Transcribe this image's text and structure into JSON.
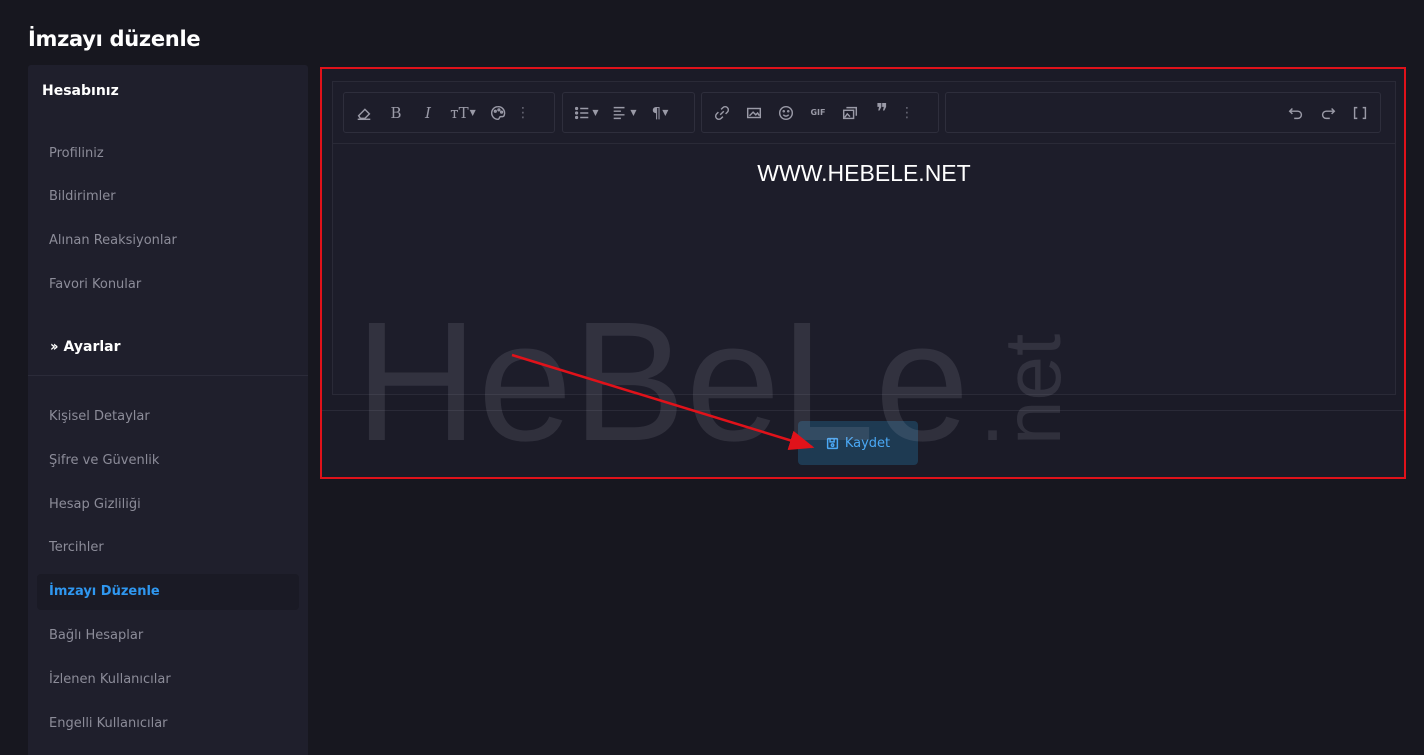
{
  "page": {
    "title": "İmzayı düzenle"
  },
  "sidebar": {
    "heading": "Hesabınız",
    "group1": [
      "Profiliniz",
      "Bildirimler",
      "Alınan Reaksiyonlar",
      "Favori Konular"
    ],
    "section_title": "Ayarlar",
    "group2": [
      "Kişisel Detaylar",
      "Şifre ve Güvenlik",
      "Hesap Gizliliği",
      "Tercihler",
      "İmzayı Düzenle",
      "Bağlı Hesaplar",
      "İzlenen Kullanıcılar",
      "Engelli Kullanıcılar"
    ],
    "active_item": "İmzayı Düzenle"
  },
  "editor": {
    "content": "WWW.HEBELE.NET",
    "toolbar_icons": [
      "eraser-icon",
      "bold-icon",
      "italic-icon",
      "font-size-icon",
      "palette-icon",
      "more-icon",
      "list-icon",
      "align-icon",
      "paragraph-icon",
      "link-icon",
      "image-icon",
      "emoji-icon",
      "gif-icon",
      "media-icon",
      "quote-icon",
      "more-icon",
      "undo-icon",
      "redo-icon",
      "fullscreen-icon"
    ],
    "gif_label": "GIF"
  },
  "save_button": {
    "label": "Kaydet"
  },
  "watermark": {
    "main": "HeBeLe",
    "dot": ".",
    "suffix": "net"
  },
  "colors": {
    "accent": "#2f97f0",
    "highlight_border": "#e0121a",
    "background": "#17171f"
  }
}
